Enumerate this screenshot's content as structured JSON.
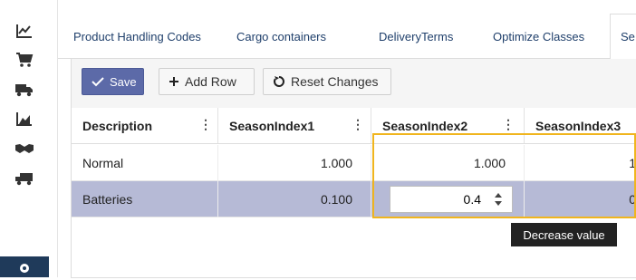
{
  "sidebar": {
    "items": [
      {
        "icon": "trend-chart-icon"
      },
      {
        "icon": "shopping-cart-icon"
      },
      {
        "icon": "truck-icon"
      },
      {
        "icon": "area-chart-icon"
      },
      {
        "icon": "handshake-icon"
      },
      {
        "icon": "delivery-truck-icon"
      },
      {
        "icon": "gear-icon"
      }
    ],
    "active_index": 6
  },
  "tabs": [
    {
      "label": "Product Handling Codes"
    },
    {
      "label": "Cargo containers"
    },
    {
      "label": "DeliveryTerms"
    },
    {
      "label": "Optimize Classes"
    },
    {
      "label": "Se",
      "active": true
    }
  ],
  "toolbar": {
    "save_label": "Save",
    "add_row_label": "Add Row",
    "reset_label": "Reset Changes"
  },
  "grid": {
    "columns": [
      "Description",
      "SeasonIndex1",
      "SeasonIndex2",
      "SeasonIndex3"
    ],
    "rows": [
      {
        "description": "Normal",
        "s1": "1.000",
        "s2": "1.000",
        "s3": "1"
      },
      {
        "description": "Batteries",
        "s1": "0.100",
        "s2": "0.4",
        "s3": "0",
        "selected": true
      }
    ],
    "editor_value": "0.4"
  },
  "tooltip": {
    "text": "Decrease value"
  },
  "colors": {
    "accent": "#5c6aa8",
    "nav_active": "#1f3a5a",
    "selected_row": "#b6bad6",
    "highlight": "#f0b51e",
    "tab_text": "#1f3f6b"
  }
}
